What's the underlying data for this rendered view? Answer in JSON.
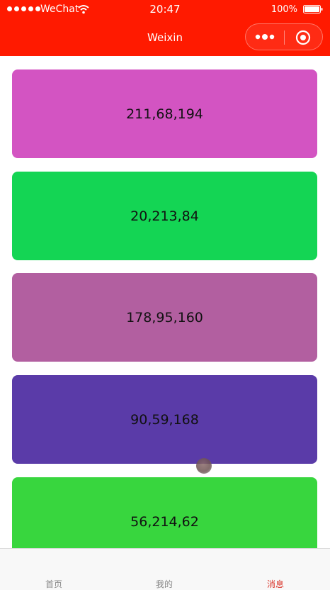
{
  "status_bar": {
    "carrier": "WeChat",
    "time": "20:47",
    "battery": "100%"
  },
  "nav": {
    "title": "Weixin"
  },
  "cards": [
    {
      "label": "211,68,194",
      "color": "#d354c2"
    },
    {
      "label": "20,213,84",
      "color": "#14d554"
    },
    {
      "label": "178,95,160",
      "color": "#b25fa0"
    },
    {
      "label": "90,59,168",
      "color": "#5a3ba8"
    },
    {
      "label": "56,214,62",
      "color": "#38d63e"
    }
  ],
  "tabbar": {
    "tabs": [
      {
        "label": "首页"
      },
      {
        "label": "我的"
      },
      {
        "label": "消息"
      }
    ]
  },
  "colors": {
    "header": "#ff1a00",
    "active_tab": "#d9352a",
    "inactive_tab": "#888888"
  }
}
